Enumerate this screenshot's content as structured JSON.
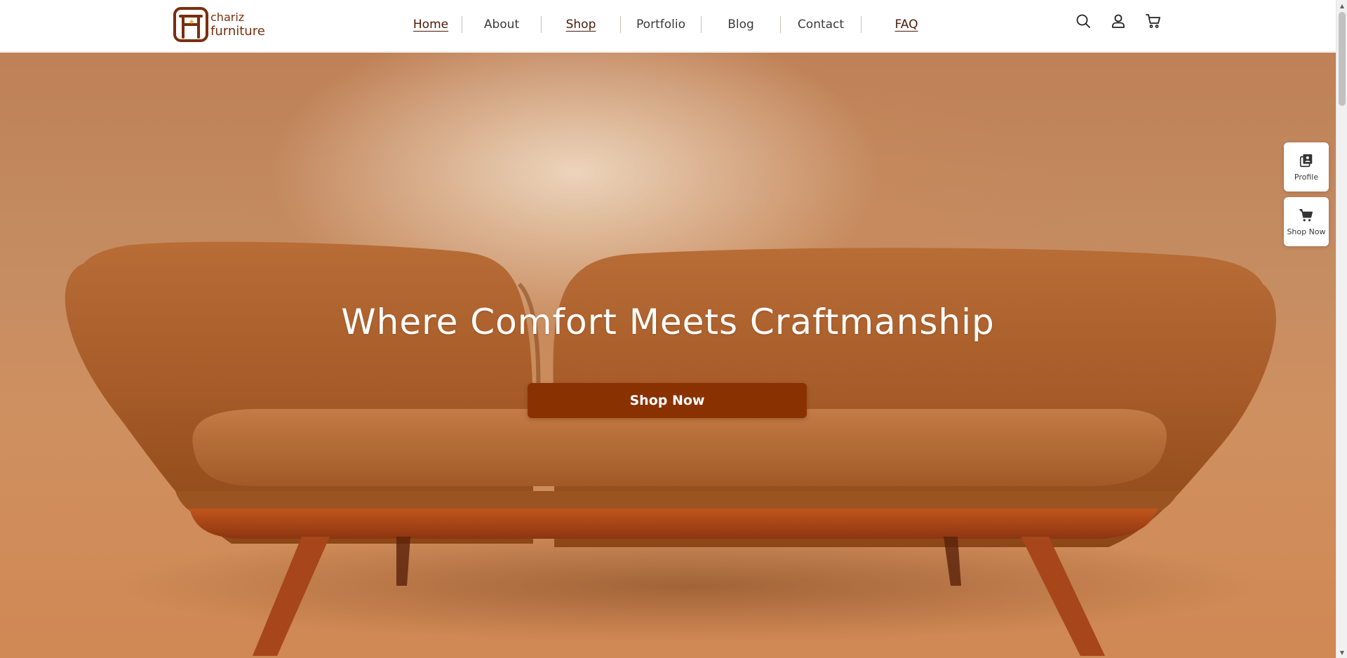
{
  "brand": {
    "name_line1": "chariz",
    "name_line2": "furniture",
    "colors": {
      "brand": "#7a2e0e",
      "accent": "#f0b43c",
      "button": "#8a3100"
    }
  },
  "nav": {
    "items": [
      {
        "label": "Home",
        "active": true
      },
      {
        "label": "About",
        "active": false
      },
      {
        "label": "Shop",
        "active": true
      },
      {
        "label": "Portfolio",
        "active": false
      },
      {
        "label": "Blog",
        "active": false
      },
      {
        "label": "Contact",
        "active": false
      },
      {
        "label": "FAQ",
        "active": true
      }
    ]
  },
  "header_icons": [
    "search-icon",
    "user-icon",
    "cart-icon"
  ],
  "hero": {
    "title": "Where Comfort Meets Craftmanship",
    "cta_label": "Shop Now"
  },
  "side_widgets": [
    {
      "label": "Profile",
      "icon": "profile-icon"
    },
    {
      "label": "Shop Now",
      "icon": "cart-icon"
    }
  ]
}
